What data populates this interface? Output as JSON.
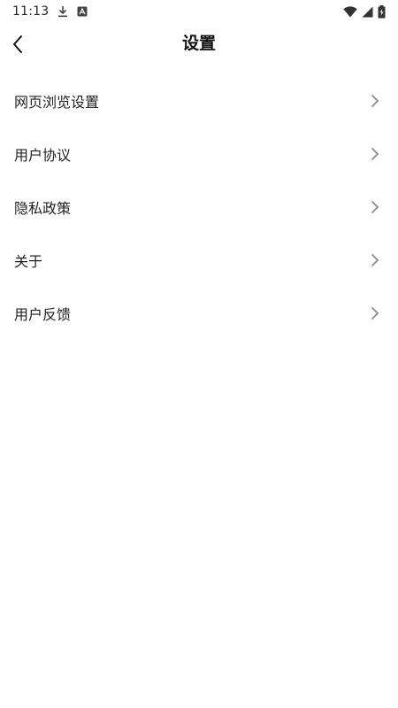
{
  "status_bar": {
    "time": "11:13",
    "icons": [
      "download-icon",
      "app-notification-icon",
      "wifi-icon",
      "cellular-signal-icon",
      "battery-charging-icon"
    ]
  },
  "header": {
    "title": "设置",
    "back_icon": "chevron-left-icon"
  },
  "settings": {
    "items": [
      {
        "label": "网页浏览设置",
        "icon": "chevron-right-icon"
      },
      {
        "label": "用户协议",
        "icon": "chevron-right-icon"
      },
      {
        "label": "隐私政策",
        "icon": "chevron-right-icon"
      },
      {
        "label": "关于",
        "icon": "chevron-right-icon"
      },
      {
        "label": "用户反馈",
        "icon": "chevron-right-icon"
      }
    ]
  },
  "colors": {
    "background": "#ffffff",
    "text": "#222222",
    "chevron": "#8a8a8a"
  }
}
